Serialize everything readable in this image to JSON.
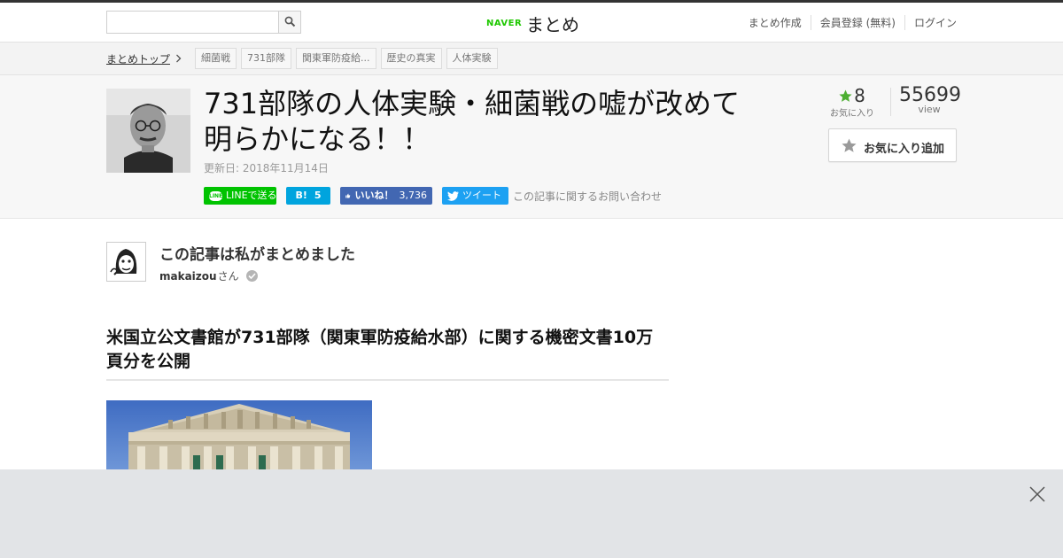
{
  "header_bar": {
    "search_placeholder": "",
    "logo_naver": "NAVER",
    "logo_matome": "まとめ",
    "nav": [
      "まとめ作成",
      "会員登録 (無料)",
      "ログイン"
    ]
  },
  "breadcrumb": {
    "top_link": "まとめトップ",
    "tags": [
      "細菌戦",
      "731部隊",
      "関東軍防疫給...",
      "歴史の真実",
      "人体実験"
    ]
  },
  "article": {
    "title": "731部隊の人体実験・細菌戦の嘘が改めて明らかになる！！",
    "updated": "更新日: 2018年11月14日",
    "social": {
      "line": "LINEで送る",
      "hatena_mark": "B!",
      "hatena_count": "5",
      "facebook": "いいね！",
      "facebook_count": "3,736",
      "twitter": "ツイート",
      "inquiry": "この記事に関するお問い合わせ"
    },
    "stats": {
      "favorites": "8",
      "favorites_label": "お気に入り",
      "views": "55699",
      "views_label": "view"
    },
    "favorite_button": "お気に入り追加"
  },
  "author": {
    "heading": "この記事は私がまとめました",
    "name": "makaizou",
    "suffix": "さん"
  },
  "content": {
    "section_heading": "米国立公文書館が731部隊（関東軍防疫給水部）に関する機密文書10万頁分を公開"
  },
  "colors": {
    "line_green": "#00c300",
    "hatena_blue": "#00a4de",
    "facebook_blue": "#4267b2",
    "twitter_blue": "#1da1f2",
    "fav_star_green": "#4cae31",
    "naver_green": "#1ec800"
  }
}
